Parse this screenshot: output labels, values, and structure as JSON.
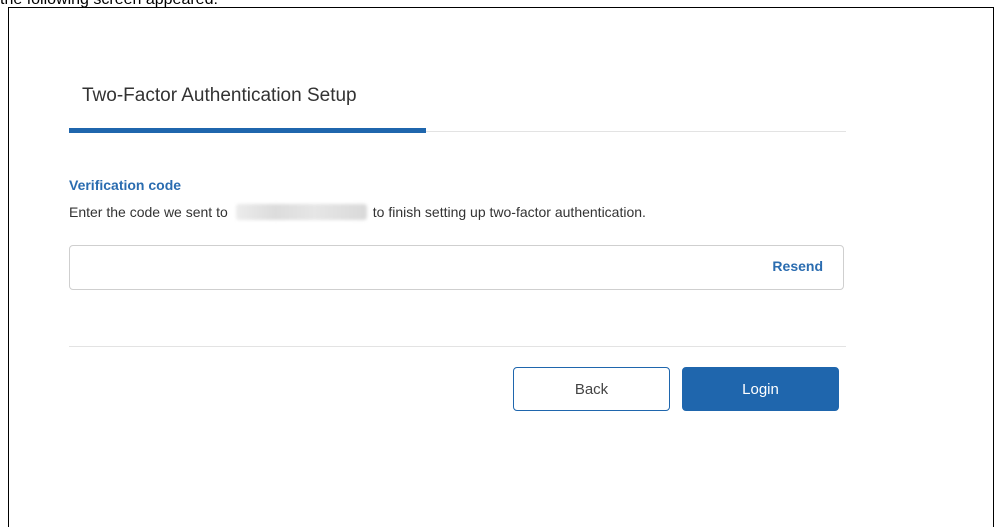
{
  "caption": {
    "text": "the following screen appeared:"
  },
  "tabs": [
    {
      "label": "Two-Factor Authentication Setup",
      "active": true
    }
  ],
  "form": {
    "label": "Verification code",
    "help_before": "Enter the code we sent to",
    "help_after": "to finish setting up two-factor authentication.",
    "code_value": "",
    "code_placeholder": "",
    "resend_label": "Resend"
  },
  "actions": {
    "back_label": "Back",
    "login_label": "Login"
  },
  "colors": {
    "accent": "#1f66ad",
    "link": "#2a6cb0",
    "border": "#cfcfcf",
    "divider": "#e3e3e3"
  }
}
